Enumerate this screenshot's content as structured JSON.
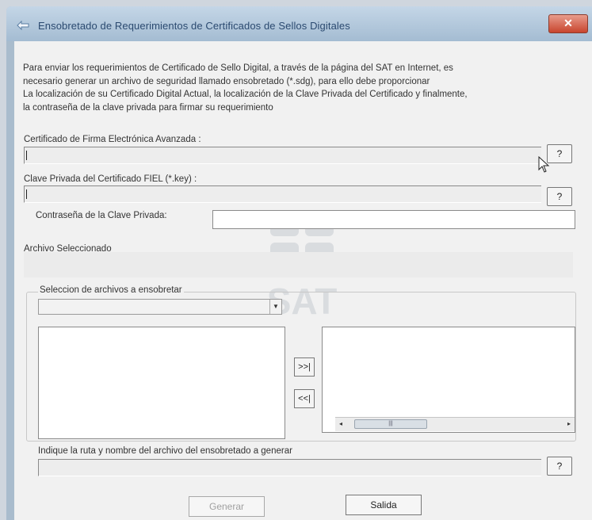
{
  "window": {
    "title": "Ensobretado de Requerimientos de Certificados de Sellos Digitales",
    "close_label": "✕",
    "accent": "#c8452e"
  },
  "intro": {
    "line1": "Para enviar los requerimientos de Certificado de Sello Digital, a través de la página del SAT en Internet, es",
    "line2": "necesario generar un archivo de seguridad llamado ensobretado (*.sdg), para ello debe proporcionar",
    "line3": "La localización de su Certificado Digital Actual, la localización de la Clave Privada del Certificado y finalmente,",
    "line4": "la contraseña de la clave privada para firmar su requerimiento"
  },
  "certificate": {
    "label": "Certificado de Firma Electrónica Avanzada :",
    "value": "",
    "browse_label": "?"
  },
  "private_key": {
    "label": "Clave Privada del Certificado FIEL (*.key) :",
    "value": "",
    "browse_label": "?"
  },
  "password": {
    "label": "Contraseña de la Clave Privada:",
    "value": ""
  },
  "selected_file": {
    "label": "Archivo Seleccionado",
    "value": ""
  },
  "file_selection": {
    "legend": "Seleccion de archivos a ensobretar",
    "combo_value": "",
    "add_label": ">>|",
    "remove_label": "<<|"
  },
  "output": {
    "label": "Indique la ruta y nombre del archivo del ensobretado a generar",
    "value": "",
    "browse_label": "?"
  },
  "footer": {
    "generate_label": "Generar",
    "exit_label": "Salida"
  },
  "watermark": {
    "text": "SAT"
  }
}
